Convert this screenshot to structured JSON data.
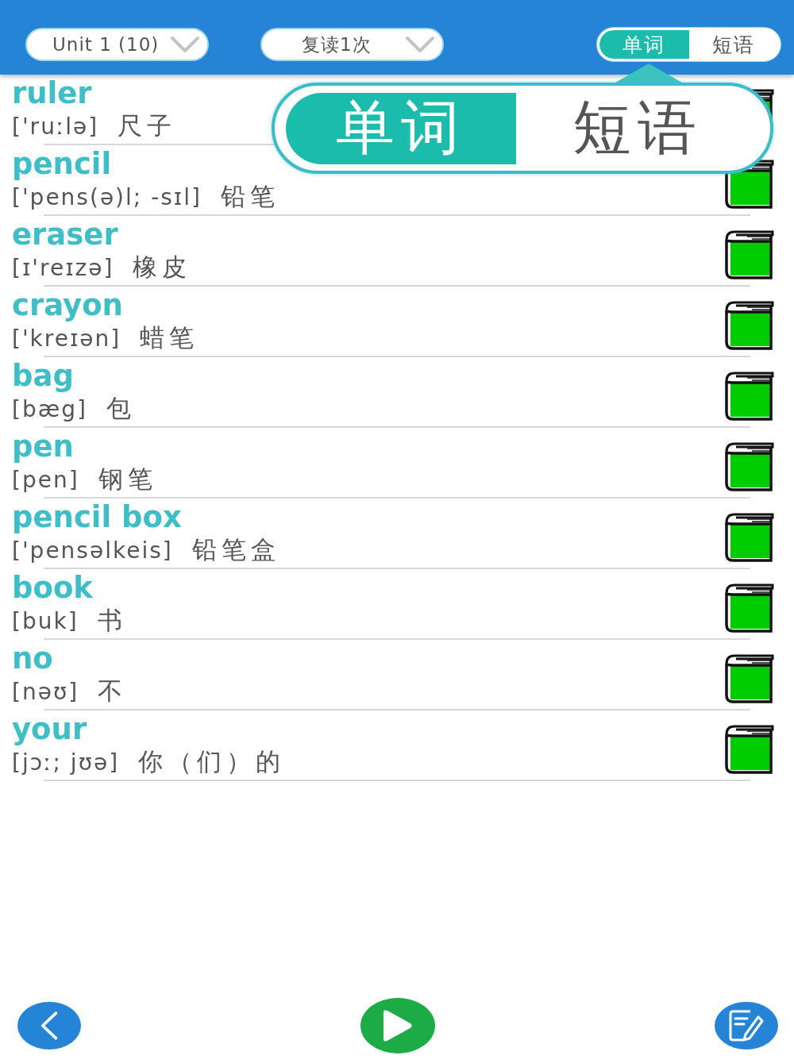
{
  "toolbar": {
    "unit_select": {
      "value": "Unit 1 (10)"
    },
    "repeat_select": {
      "value": "复读1次"
    },
    "mode_tabs": [
      {
        "label": "单词",
        "selected": true
      },
      {
        "label": "短语",
        "selected": false
      }
    ]
  },
  "hint_bubble": {
    "segments": [
      {
        "label": "单词",
        "selected": true
      },
      {
        "label": "短语",
        "selected": false
      }
    ]
  },
  "words": [
    {
      "word": "ruler",
      "phonetic": "['ruːlə]",
      "meaning": "尺子"
    },
    {
      "word": "pencil",
      "phonetic": "['pens(ə)l; -sɪl]",
      "meaning": "铅笔"
    },
    {
      "word": "eraser",
      "phonetic": "[ɪ'reɪzə]",
      "meaning": "橡皮"
    },
    {
      "word": "crayon",
      "phonetic": "['kreɪən]",
      "meaning": "蜡笔"
    },
    {
      "word": "bag",
      "phonetic": "[bæg]",
      "meaning": "包"
    },
    {
      "word": "pen",
      "phonetic": "[pen]",
      "meaning": "钢笔"
    },
    {
      "word": "pencil box",
      "phonetic": "['pensəlkeis]",
      "meaning": "铅笔盒"
    },
    {
      "word": "book",
      "phonetic": "[buk]",
      "meaning": "书"
    },
    {
      "word": "no",
      "phonetic": "[nəʊ]",
      "meaning": "不"
    },
    {
      "word": "your",
      "phonetic": "[jɔː; jʊə]",
      "meaning": "你（们）的"
    }
  ]
}
